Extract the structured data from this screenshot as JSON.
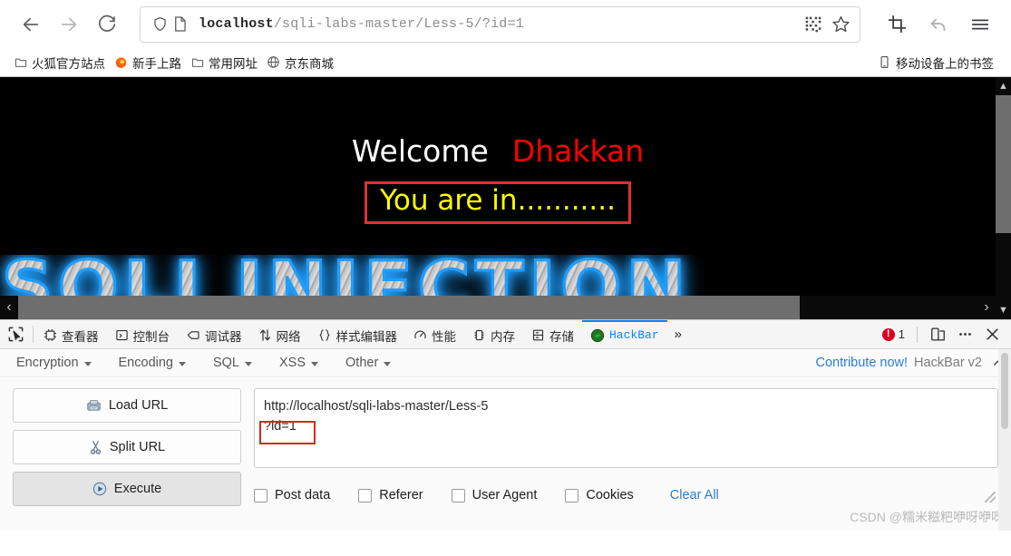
{
  "browser": {
    "nav": {
      "back_label": "Back",
      "forward_label": "Forward",
      "reload_label": "Reload"
    },
    "url": {
      "host": "localhost",
      "path": "/sqli-labs-master/Less-5/?id=1",
      "full": "localhost/sqli-labs-master/Less-5/?id=1"
    },
    "bookmarks": [
      {
        "label": "火狐官方站点",
        "icon": "folder-icon"
      },
      {
        "label": "新手上路",
        "icon": "firefox-icon"
      },
      {
        "label": "常用网址",
        "icon": "folder-icon"
      },
      {
        "label": "京东商城",
        "icon": "globe-icon"
      }
    ],
    "mobile_bookmarks": {
      "label": "移动设备上的书签",
      "icon": "mobile-icon"
    }
  },
  "page": {
    "welcome": "Welcome",
    "name": "Dhakkan",
    "status": "You are in...........",
    "banner_text": "SQLI INJECTION",
    "colors": {
      "welcome": "#ffffff",
      "name": "#fe0000",
      "status_text": "#ffff00",
      "status_border": "#e03030",
      "background": "#000000",
      "neon": "#1f9dfb"
    }
  },
  "devtools": {
    "tabs": [
      {
        "label": "查看器",
        "icon": "inspector-icon",
        "active": false
      },
      {
        "label": "控制台",
        "icon": "console-icon",
        "active": false
      },
      {
        "label": "调试器",
        "icon": "debugger-icon",
        "active": false
      },
      {
        "label": "网络",
        "icon": "network-icon",
        "active": false
      },
      {
        "label": "样式编辑器",
        "icon": "style-editor-icon",
        "active": false
      },
      {
        "label": "性能",
        "icon": "performance-icon",
        "active": false
      },
      {
        "label": "内存",
        "icon": "memory-icon",
        "active": false
      },
      {
        "label": "存储",
        "icon": "storage-icon",
        "active": false
      },
      {
        "label": "HackBar",
        "icon": "hackbar-icon",
        "active": true
      }
    ],
    "overflow_label": "»",
    "error_count": "1",
    "close_label": "×"
  },
  "hackbar": {
    "menus": [
      {
        "label": "Encryption"
      },
      {
        "label": "Encoding"
      },
      {
        "label": "SQL"
      },
      {
        "label": "XSS"
      },
      {
        "label": "Other"
      }
    ],
    "contribute_label": "Contribute now!",
    "version_label": "HackBar v2",
    "buttons": [
      {
        "label": "Load URL",
        "icon": "load-url-icon"
      },
      {
        "label": "Split URL",
        "icon": "scissors-icon"
      },
      {
        "label": "Execute",
        "icon": "play-icon"
      }
    ],
    "url_field": {
      "line1": "http://localhost/sqli-labs-master/Less-5",
      "line2": "?id=1",
      "value": "http://localhost/sqli-labs-master/Less-5\n?id=1",
      "placeholder": ""
    },
    "checkboxes": [
      {
        "label": "Post data",
        "checked": false
      },
      {
        "label": "Referer",
        "checked": false
      },
      {
        "label": "User Agent",
        "checked": false
      },
      {
        "label": "Cookies",
        "checked": false
      }
    ],
    "clear_all_label": "Clear All"
  },
  "watermark": "CSDN @糯米糍粑咿呀咿呀"
}
